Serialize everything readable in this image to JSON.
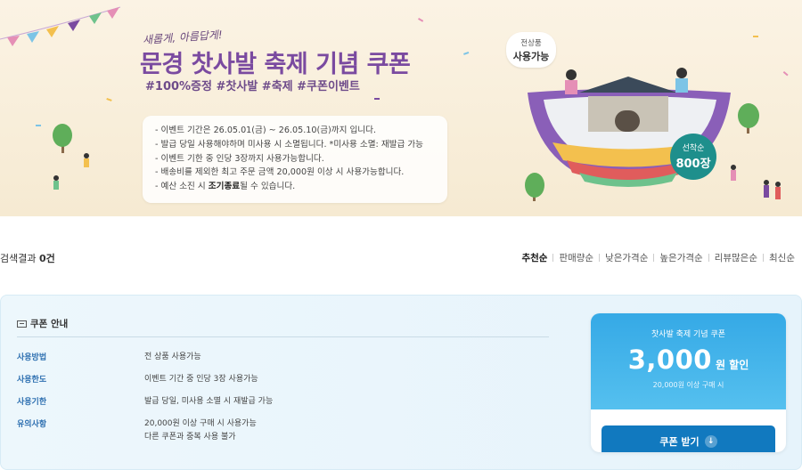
{
  "banner": {
    "subtitle": "새롭게, 아름답게!",
    "title": "문경 찻사발 축제 기념 쿠폰",
    "hashtags": "#100%증정 #찻사발 #축제 #쿠폰이벤트",
    "notices": [
      "- 이벤트 기간은 26.05.01(금) ~ 26.05.10(금)까지 입니다.",
      "- 발급 당일 사용해야하며 미사용 시 소멸됩니다. *미사용 소멸: 재발급 가능",
      "- 이벤트 기한 중 인당 3장까지 사용가능합니다.",
      "- 배송비를 제외한 최고 주문 금액 20,000원 이상 시 사용가능합니다."
    ],
    "last_notice_prefix": "- 예산 소진 시 ",
    "last_notice_bold": "조기종료",
    "last_notice_suffix": "될 수 있습니다.",
    "bubble_small": "전상품",
    "bubble_big": "사용가능",
    "badge_small": "선착순",
    "badge_big": "800장",
    "colors": {
      "title": "#7a4aa0",
      "badge": "#1e8f8c"
    }
  },
  "results": {
    "label": "검색결과",
    "count": "0건"
  },
  "sort_options": [
    "추천순",
    "판매량순",
    "낮은가격순",
    "높은가격순",
    "리뷰많은순",
    "최신순"
  ],
  "coupon_info": {
    "heading": "쿠폰 안내",
    "rows": [
      {
        "key": "사용방법",
        "value": "전 상품 사용가능"
      },
      {
        "key": "사용한도",
        "value": "이벤트 기간 중 인당 3장 사용가능"
      },
      {
        "key": "사용기한",
        "value": "발급 당일, 미사용 소멸 시 재발급 가능"
      },
      {
        "key": "유의사항",
        "value": "20,000원 이상 구매 시 사용가능",
        "value2": "다른 쿠폰과 중복 사용 불가"
      }
    ]
  },
  "coupon_card": {
    "name": "찻사발 축제 기념 쿠폰",
    "amount": "3,000",
    "unit": "원 할인",
    "min_purchase": "20,000원 이상 구매 시",
    "button": "쿠폰 받기",
    "button_icon": "↓",
    "colors": {
      "top": "#35a9e6",
      "button": "#1179bf"
    }
  }
}
